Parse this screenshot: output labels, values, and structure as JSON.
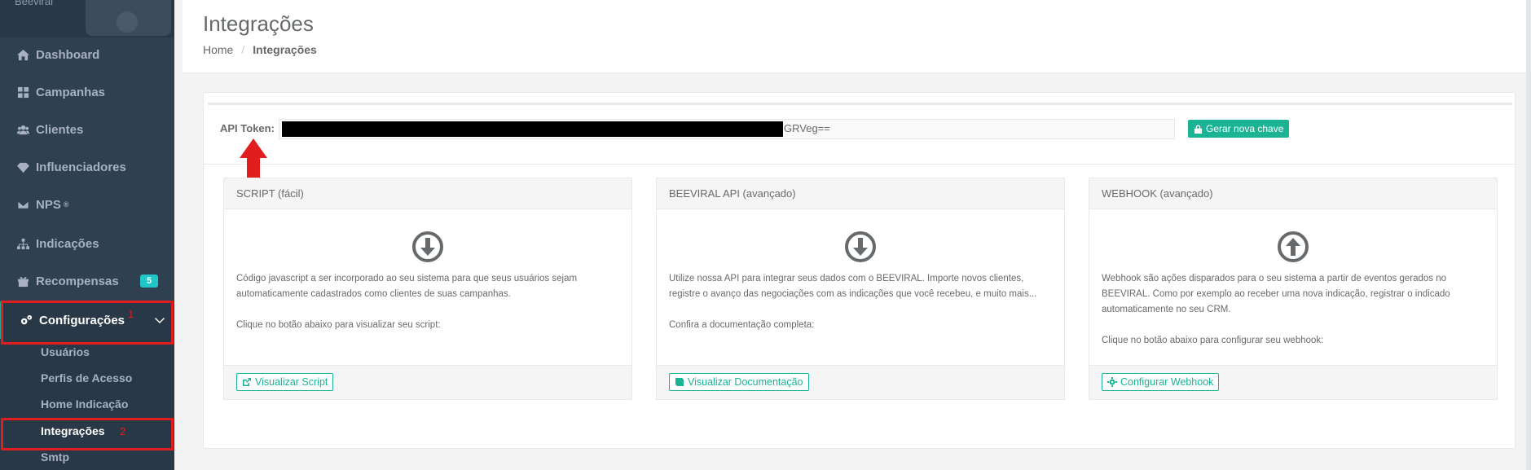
{
  "sidebar": {
    "profile_name": "Beeviral",
    "items": [
      {
        "label": "Dashboard",
        "icon": "home-icon"
      },
      {
        "label": "Campanhas",
        "icon": "grid-icon"
      },
      {
        "label": "Clientes",
        "icon": "users-icon"
      },
      {
        "label": "Influenciadores",
        "icon": "diamond-icon"
      },
      {
        "label": "NPS",
        "sup": "®",
        "icon": "envelope-icon"
      },
      {
        "label": "Indicações",
        "icon": "sitemap-icon"
      },
      {
        "label": "Recompensas",
        "icon": "gift-icon",
        "badge": "5"
      },
      {
        "label": "Configurações",
        "icon": "cogs-icon"
      }
    ],
    "sub_items": [
      "Usuários",
      "Perfis de Acesso",
      "Home Indicação",
      "Integrações",
      "Smtp"
    ],
    "annotations": [
      "1",
      "2"
    ]
  },
  "header": {
    "title": "Integrações",
    "breadcrumb": {
      "home": "Home",
      "separator": "/",
      "current": "Integrações"
    }
  },
  "token": {
    "label": "API Token:",
    "visible_tail": "GRVeg==",
    "generate_button": "Gerar nova chave"
  },
  "panels": [
    {
      "title": "SCRIPT (fácil)",
      "icon": "arrow-circle-down-icon",
      "para1": "Código javascript a ser incorporado ao seu sistema para que seus usuários sejam automaticamente cadastrados como clientes de suas campanhas.",
      "para2": "Clique no botão abaixo para visualizar seu script:",
      "button": "Visualizar Script"
    },
    {
      "title": "BEEVIRAL API (avançado)",
      "icon": "arrow-circle-down-icon",
      "para1": "Utilize nossa API para integrar seus dados com o BEEVIRAL. Importe novos clientes, registre o avanço das negociações com as indicações que você recebeu, e muito mais...",
      "para2": "Confira a documentação completa:",
      "button": "Visualizar Documentação"
    },
    {
      "title": "WEBHOOK (avançado)",
      "icon": "arrow-circle-up-icon",
      "para1": "Webhook são ações disparados para o seu sistema a partir de eventos gerados no BEEVIRAL. Como por exemplo ao receber uma nova indicação, registrar o indicado automaticamente no seu CRM.",
      "para2": "Clique no botão abaixo para configurar seu webhook:",
      "button": "Configurar Webhook"
    }
  ],
  "colors": {
    "sidebar_bg": "#2f4050",
    "accent": "#1ab394",
    "badge": "#23c6c8",
    "annotation_red": "#e01e1e"
  }
}
